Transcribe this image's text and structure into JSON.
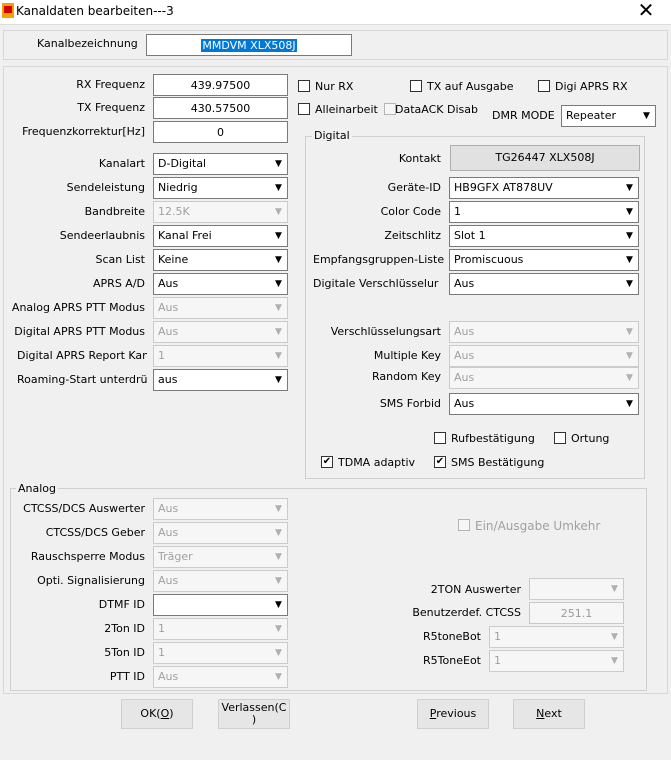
{
  "window": {
    "title": "Kanaldaten bearbeiten---3",
    "close": "✕"
  },
  "channel": {
    "name_label": "Kanalbezeichnung",
    "name_value": "MMDVM XLX508J"
  },
  "freq": {
    "rx_label": "RX Frequenz",
    "rx_value": "439.97500",
    "tx_label": "TX Frequenz",
    "tx_value": "430.57500",
    "corr_label": "Frequenzkorrektur[Hz]",
    "corr_value": "0"
  },
  "checks_top": {
    "nur_rx": "Nur RX",
    "tx_auf_ausgabe": "TX auf Ausgabe",
    "digi_aprs_rx": "Digi APRS RX",
    "alleinarbeit": "Alleinarbeit",
    "dataack": "DataACK Disab"
  },
  "dmr_mode": {
    "label": "DMR MODE",
    "value": "Repeater"
  },
  "left": {
    "kanalart": {
      "label": "Kanalart",
      "value": "D-Digital"
    },
    "sendeleistung": {
      "label": "Sendeleistung",
      "value": "Niedrig"
    },
    "bandbreite": {
      "label": "Bandbreite",
      "value": "12.5K"
    },
    "sendeerlaubnis": {
      "label": "Sendeerlaubnis",
      "value": "Kanal Frei"
    },
    "scan_list": {
      "label": "Scan List",
      "value": "Keine"
    },
    "aprs_ad": {
      "label": "APRS A/D",
      "value": "Aus"
    },
    "analog_aprs_ptt": {
      "label": "Analog APRS PTT Modus",
      "value": "Aus"
    },
    "digital_aprs_ptt": {
      "label": "Digital APRS PTT Modus",
      "value": "Aus"
    },
    "digital_aprs_report": {
      "label": "Digital APRS Report Kan",
      "value": "1"
    },
    "roaming": {
      "label": "Roaming-Start unterdrü",
      "value": "aus"
    }
  },
  "digital": {
    "group_title": "Digital",
    "kontakt": {
      "label": "Kontakt",
      "value": "TG26447 XLX508J"
    },
    "geraete_id": {
      "label": "Geräte-ID",
      "value": "HB9GFX AT878UV"
    },
    "color_code": {
      "label": "Color Code",
      "value": "1"
    },
    "zeitschlitz": {
      "label": "Zeitschlitz",
      "value": "Slot 1"
    },
    "empfangsgruppen": {
      "label": "Empfangsgruppen-Liste",
      "value": "Promiscuous"
    },
    "verschluesselung": {
      "label": "Digitale Verschlüsselur",
      "value": "Aus"
    },
    "verschluesselungsart": {
      "label": "Verschlüsselungsart",
      "value": "Aus"
    },
    "multiple_key": {
      "label": "Multiple Key",
      "value": "Aus"
    },
    "random_key": {
      "label": "Random Key",
      "value": "Aus"
    },
    "sms_forbid": {
      "label": "SMS Forbid",
      "value": "Aus"
    },
    "rufbestaetigung": "Rufbestätigung",
    "ortung": "Ortung",
    "tdma": "TDMA adaptiv",
    "sms_bestaetigung": "SMS Bestätigung"
  },
  "analog": {
    "group_title": "Analog",
    "ctcss_auswerter": {
      "label": "CTCSS/DCS Auswerter",
      "value": "Aus"
    },
    "ctcss_geber": {
      "label": "CTCSS/DCS Geber",
      "value": "Aus"
    },
    "rauschsperre": {
      "label": "Rauschsperre Modus",
      "value": "Träger"
    },
    "opti_signal": {
      "label": "Opti. Signalisierung",
      "value": "Aus"
    },
    "dtmf_id": {
      "label": "DTMF ID",
      "value": ""
    },
    "twoton_id": {
      "label": "2Ton ID",
      "value": "1"
    },
    "fiveton_id": {
      "label": "5Ton ID",
      "value": "1"
    },
    "ptt_id": {
      "label": "PTT ID",
      "value": "Aus"
    },
    "umkehr": "Ein/Ausgabe Umkehr",
    "twoton_auswerter": {
      "label": "2TON Auswerter",
      "value": ""
    },
    "benutzer_ctcss": {
      "label": "Benutzerdef. CTCSS",
      "value": "251.1"
    },
    "r5_bot": {
      "label": "R5toneBot",
      "value": "1"
    },
    "r5_eot": {
      "label": "R5ToneEot",
      "value": "1"
    }
  },
  "buttons": {
    "ok": "OK(",
    "ok_key": "O",
    "ok_end": ")",
    "verlassen": "Verlassen(C",
    "verlassen_end": ")",
    "previous_key": "P",
    "previous": "revious",
    "next_key": "N",
    "next": "ext"
  },
  "icons": {
    "dropdown": "▼",
    "check": "✔"
  }
}
